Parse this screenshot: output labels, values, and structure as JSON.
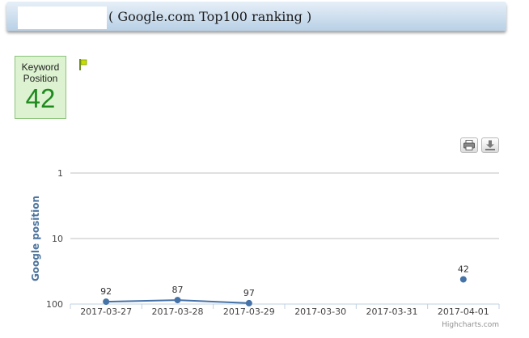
{
  "header": {
    "title": "( Google.com Top100 ranking )"
  },
  "keyword_box": {
    "label_line1": "Keyword",
    "label_line2": "Position",
    "value": "42"
  },
  "icons": {
    "flag": "flag-icon",
    "print": "print-icon",
    "download": "download-icon"
  },
  "colors": {
    "series": "#4572a7",
    "keyword_value": "#1e8a1e",
    "keyword_bg": "#dcf2d0"
  },
  "chart_data": {
    "type": "line",
    "ylabel": "Google position",
    "y_scale": "log",
    "y_reversed": true,
    "ylim": [
      1,
      100
    ],
    "y_ticks": [
      "1",
      "10",
      "100"
    ],
    "categories": [
      "2017-03-27",
      "2017-03-28",
      "2017-03-29",
      "2017-03-30",
      "2017-03-31",
      "2017-04-01"
    ],
    "series": [
      {
        "values": [
          92,
          87,
          97,
          null,
          null,
          42
        ]
      }
    ],
    "grid": true,
    "credit": "Highcharts.com"
  }
}
